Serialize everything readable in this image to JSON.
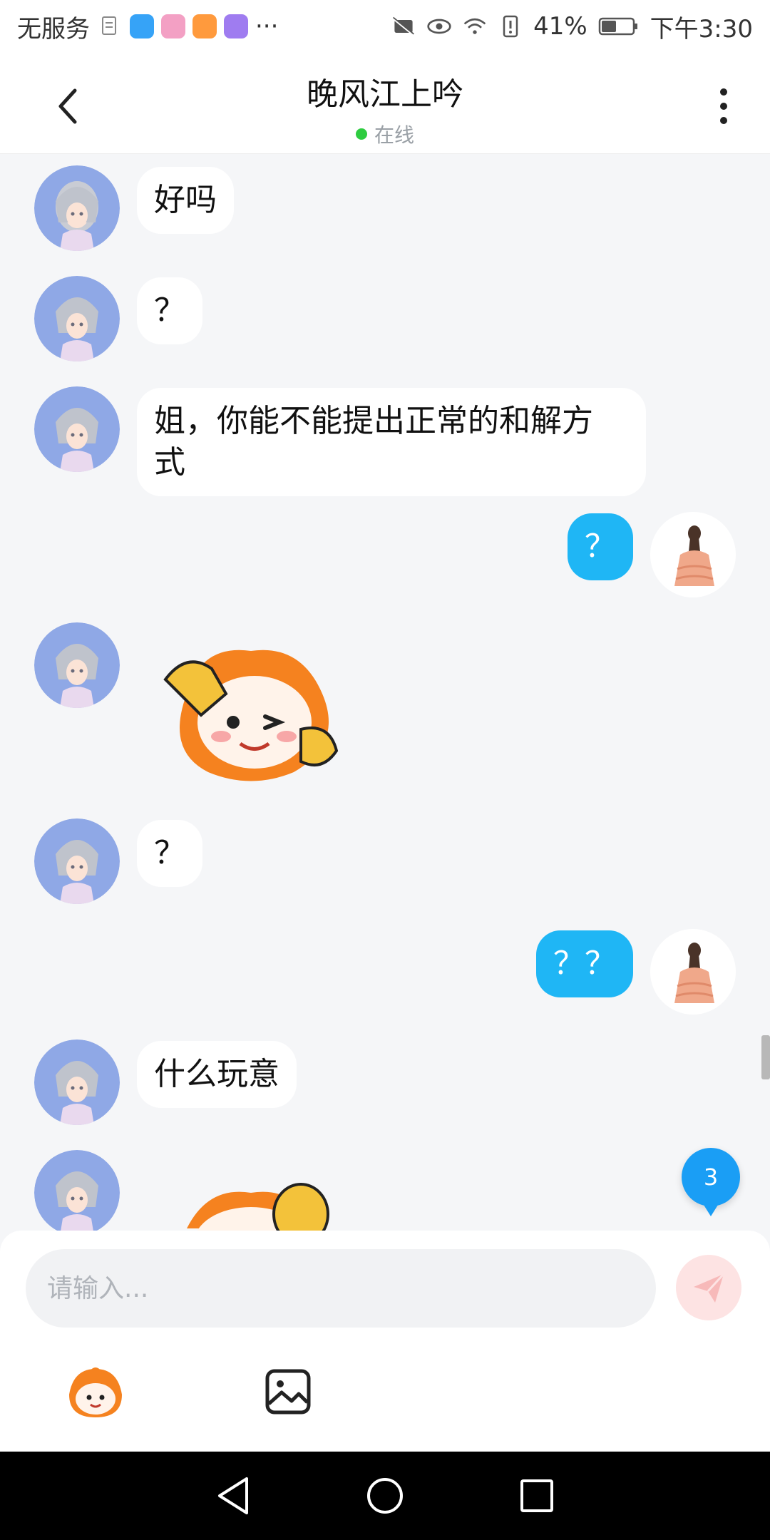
{
  "status_bar": {
    "carrier": "无服务",
    "battery_percent": "41%",
    "time": "下午3:30",
    "overflow": "···"
  },
  "header": {
    "title": "晚风江上吟",
    "status": "在线"
  },
  "messages": [
    {
      "side": "in",
      "type": "text",
      "text": "好吗"
    },
    {
      "side": "in",
      "type": "text",
      "text": "？"
    },
    {
      "side": "in",
      "type": "text",
      "text": "姐，你能不能提出正常的和解方式"
    },
    {
      "side": "out",
      "type": "text",
      "text": "？"
    },
    {
      "side": "in",
      "type": "sticker"
    },
    {
      "side": "in",
      "type": "text",
      "text": "？"
    },
    {
      "side": "out",
      "type": "text",
      "text": "？？"
    },
    {
      "side": "in",
      "type": "text",
      "text": "什么玩意"
    },
    {
      "side": "in",
      "type": "sticker"
    }
  ],
  "text_lines": {
    "msg3_line1": "姐，你能不能提出正常的和解方",
    "msg3_line2": "式"
  },
  "unread_count": "3",
  "input": {
    "placeholder": "请输入..."
  },
  "colors": {
    "outgoing_bubble": "#1fb6f5",
    "online_dot": "#2ecc40",
    "badge": "#1a9ef5",
    "send_button": "#fde3e3"
  }
}
